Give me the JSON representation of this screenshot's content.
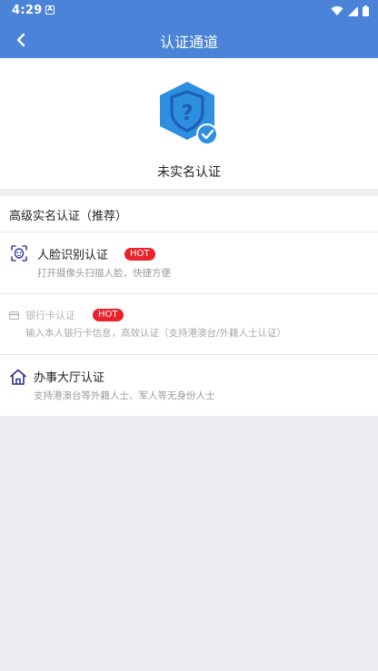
{
  "status_bar": {
    "time": "4:29",
    "notification_glyph": "A",
    "icons": [
      "wifi-icon",
      "signal-icon",
      "battery-icon"
    ]
  },
  "app_bar": {
    "title": "认证通道",
    "back_icon": "chevron-left-icon"
  },
  "verification_status": {
    "icon": "shield-question-check-icon",
    "text": "未实名认证"
  },
  "options_section": {
    "title": "高级实名认证（推荐）",
    "options": [
      {
        "icon": "face-scan-icon",
        "title": "人脸识别认证",
        "badge": "HOT",
        "subtitle": "打开摄像头扫描人脸，快捷方便",
        "enabled": true
      },
      {
        "icon": "bank-card-icon",
        "title": "银行卡认证",
        "badge": "HOT",
        "subtitle": "输入本人银行卡信息，高效认证（支持港澳台/外籍人士认证）",
        "enabled": false
      },
      {
        "icon": "home-icon",
        "title": "办事大厅认证",
        "badge": "",
        "subtitle": "支持港澳台等外籍人士、军人等无身份人士",
        "enabled": true
      }
    ]
  },
  "colors": {
    "header": "#4a83d8",
    "hot_badge": "#e8232a",
    "background": "#ededf2"
  }
}
